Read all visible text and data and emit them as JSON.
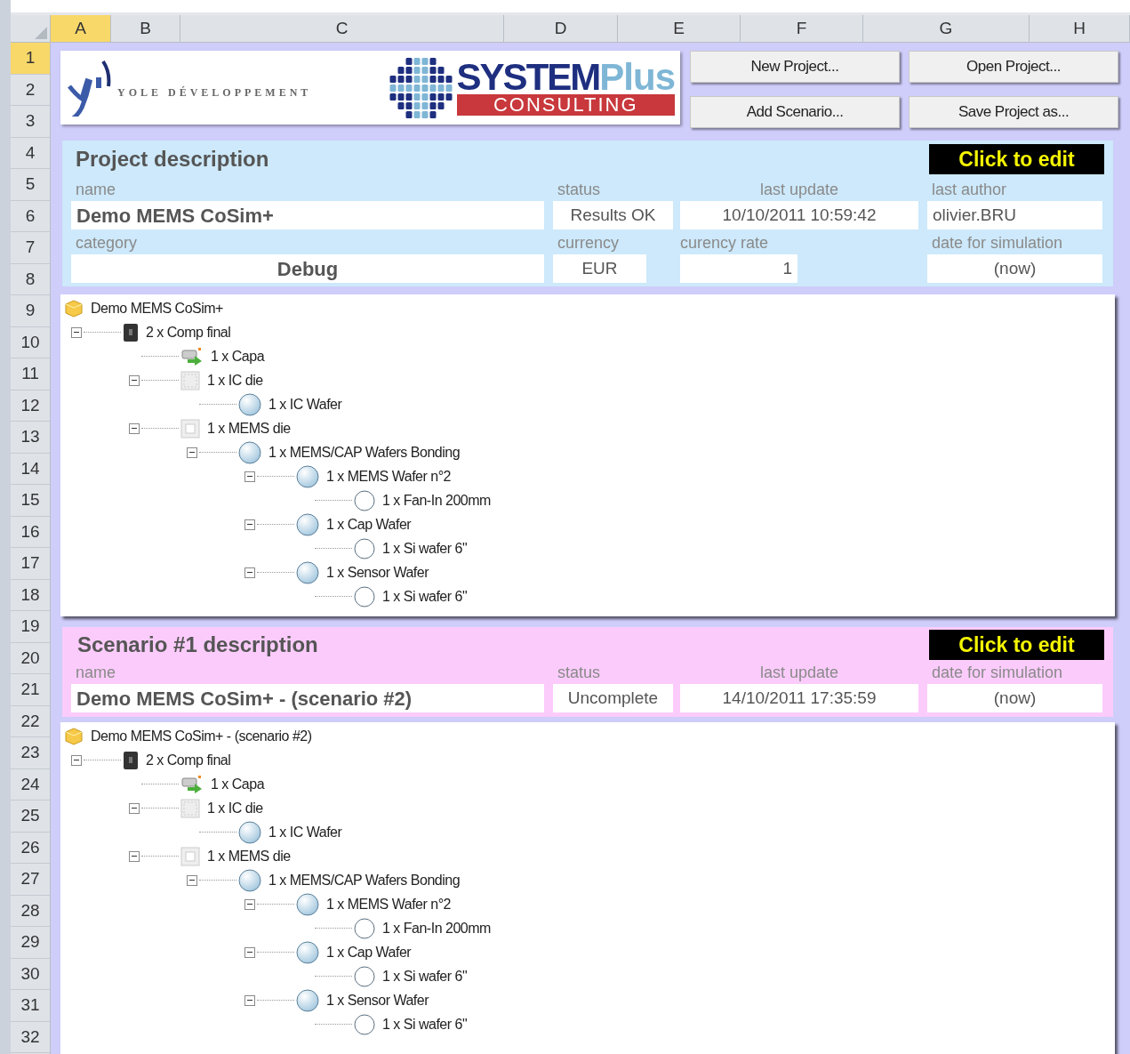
{
  "columns": [
    {
      "label": "A",
      "selected": true
    },
    {
      "label": "B",
      "selected": false
    },
    {
      "label": "C",
      "selected": false
    },
    {
      "label": "D",
      "selected": false
    },
    {
      "label": "E",
      "selected": false
    },
    {
      "label": "F",
      "selected": false
    },
    {
      "label": "G",
      "selected": false
    },
    {
      "label": "H",
      "selected": false
    }
  ],
  "rows": [
    {
      "label": "1",
      "selected": true
    },
    {
      "label": "2",
      "selected": false
    },
    {
      "label": "3",
      "selected": false
    },
    {
      "label": "4",
      "selected": false
    },
    {
      "label": "5",
      "selected": false
    },
    {
      "label": "6",
      "selected": false
    },
    {
      "label": "7",
      "selected": false
    },
    {
      "label": "8",
      "selected": false
    },
    {
      "label": "9",
      "selected": false
    },
    {
      "label": "10",
      "selected": false
    },
    {
      "label": "11",
      "selected": false
    },
    {
      "label": "12",
      "selected": false
    },
    {
      "label": "13",
      "selected": false
    },
    {
      "label": "14",
      "selected": false
    },
    {
      "label": "15",
      "selected": false
    },
    {
      "label": "16",
      "selected": false
    },
    {
      "label": "17",
      "selected": false
    },
    {
      "label": "18",
      "selected": false
    },
    {
      "label": "19",
      "selected": false
    },
    {
      "label": "20",
      "selected": false
    },
    {
      "label": "21",
      "selected": false
    },
    {
      "label": "22",
      "selected": false
    },
    {
      "label": "23",
      "selected": false
    },
    {
      "label": "24",
      "selected": false
    },
    {
      "label": "25",
      "selected": false
    },
    {
      "label": "26",
      "selected": false
    },
    {
      "label": "27",
      "selected": false
    },
    {
      "label": "28",
      "selected": false
    },
    {
      "label": "29",
      "selected": false
    },
    {
      "label": "30",
      "selected": false
    },
    {
      "label": "31",
      "selected": false
    },
    {
      "label": "32",
      "selected": false
    }
  ],
  "logos": {
    "yole": "YOLE DÉVELOPPEMENT",
    "system": "SYSTEM",
    "plus": "Plus",
    "consulting": "CONSULTING"
  },
  "buttons": [
    "New Project...",
    "Open Project...",
    "Add Scenario...",
    "Save Project as..."
  ],
  "project": {
    "title": "Project description",
    "edit_button": "Click to edit",
    "name": {
      "label": "name",
      "value": "Demo MEMS CoSim+"
    },
    "status": {
      "label": "status",
      "value": "Results OK"
    },
    "last_update": {
      "label": "last update",
      "value": "10/10/2011  10:59:42"
    },
    "last_author": {
      "label": "last author",
      "value": "olivier.BRU"
    },
    "category": {
      "label": "category",
      "value": "Debug"
    },
    "currency": {
      "label": "currency",
      "value": "EUR"
    },
    "currency_rate": {
      "label": "curency rate",
      "value": "1"
    },
    "date_for_simulation": {
      "label": "date for simulation",
      "value": "(now)"
    }
  },
  "project_tree": {
    "label": "Demo MEMS CoSim+",
    "kind": "project",
    "children": [
      {
        "label": "2 x Comp final",
        "kind": "chip",
        "expanded": true,
        "children": [
          {
            "label": "1 x Capa",
            "kind": "part"
          },
          {
            "label": "1 x IC die",
            "kind": "die",
            "expanded": true,
            "children": [
              {
                "label": "1 x IC Wafer",
                "kind": "wafer"
              }
            ]
          },
          {
            "label": "1 x MEMS die",
            "kind": "mems-die",
            "expanded": true,
            "children": [
              {
                "label": "1 x MEMS/CAP Wafers Bonding",
                "kind": "wafer",
                "expanded": true,
                "children": [
                  {
                    "label": "1 x MEMS Wafer n°2",
                    "kind": "wafer",
                    "expanded": true,
                    "children": [
                      {
                        "label": "1 x Fan-In 200mm",
                        "kind": "raw-wafer"
                      }
                    ]
                  },
                  {
                    "label": "1 x Cap Wafer",
                    "kind": "wafer",
                    "expanded": true,
                    "children": [
                      {
                        "label": "1 x Si wafer 6\"",
                        "kind": "raw-wafer"
                      }
                    ]
                  },
                  {
                    "label": "1 x Sensor Wafer",
                    "kind": "wafer",
                    "expanded": true,
                    "children": [
                      {
                        "label": "1 x Si wafer 6\"",
                        "kind": "raw-wafer"
                      }
                    ]
                  }
                ]
              }
            ]
          }
        ]
      }
    ]
  },
  "scenario": {
    "title": "Scenario #1 description",
    "edit_button": "Click to edit",
    "name": {
      "label": "name",
      "value": "Demo MEMS CoSim+ - (scenario #2)"
    },
    "status": {
      "label": "status",
      "value": "Uncomplete"
    },
    "last_update": {
      "label": "last update",
      "value": "14/10/2011  17:35:59"
    },
    "date_for_simulation": {
      "label": "date for simulation",
      "value": "(now)"
    }
  },
  "scenario_tree": {
    "label": "Demo MEMS CoSim+ - (scenario #2)",
    "kind": "project",
    "children": [
      {
        "label": "2 x Comp final",
        "kind": "chip",
        "expanded": true,
        "children": [
          {
            "label": "1 x Capa",
            "kind": "part"
          },
          {
            "label": "1 x IC die",
            "kind": "die",
            "expanded": true,
            "children": [
              {
                "label": "1 x IC Wafer",
                "kind": "wafer"
              }
            ]
          },
          {
            "label": "1 x MEMS die",
            "kind": "mems-die",
            "expanded": true,
            "children": [
              {
                "label": "1 x MEMS/CAP Wafers Bonding",
                "kind": "wafer",
                "expanded": true,
                "children": [
                  {
                    "label": "1 x MEMS Wafer n°2",
                    "kind": "wafer",
                    "expanded": true,
                    "children": [
                      {
                        "label": "1 x Fan-In 200mm",
                        "kind": "raw-wafer"
                      }
                    ]
                  },
                  {
                    "label": "1 x Cap Wafer",
                    "kind": "wafer",
                    "expanded": true,
                    "children": [
                      {
                        "label": "1 x Si wafer 6\"",
                        "kind": "raw-wafer"
                      }
                    ]
                  },
                  {
                    "label": "1 x Sensor Wafer",
                    "kind": "wafer",
                    "expanded": true,
                    "children": [
                      {
                        "label": "1 x Si wafer 6\"",
                        "kind": "raw-wafer"
                      }
                    ]
                  }
                ]
              }
            ]
          }
        ]
      }
    ]
  }
}
